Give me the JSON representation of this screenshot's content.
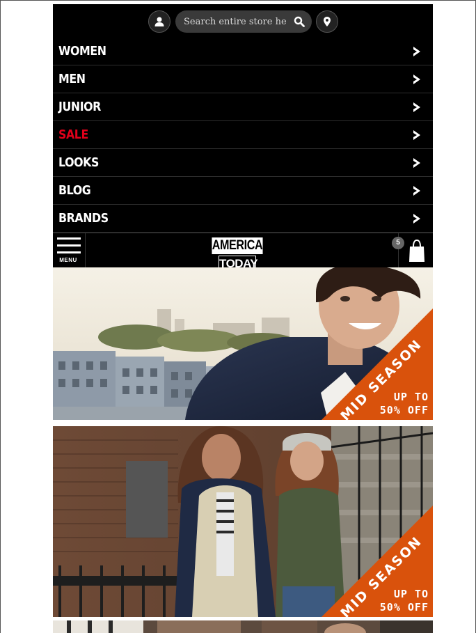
{
  "search": {
    "placeholder": "Search entire store he"
  },
  "icons": {
    "account": "user-icon",
    "search": "search-icon",
    "location": "map-pin-icon",
    "chevron": "chevron-right-icon",
    "cart": "shopping-bag-icon",
    "menu": "hamburger-icon"
  },
  "menu": {
    "items": [
      {
        "label": "WOMEN"
      },
      {
        "label": "MEN"
      },
      {
        "label": "JUNIOR"
      },
      {
        "label": "SALE"
      },
      {
        "label": "LOOKS"
      },
      {
        "label": "BLOG"
      },
      {
        "label": "BRANDS"
      }
    ]
  },
  "header": {
    "menu_label": "MENU",
    "logo_line1": "AMERICA",
    "logo_line2": "TODAY",
    "cart_count": "5"
  },
  "banners": [
    {
      "promo_season": "MID SEASON",
      "promo_line1": "UP TO",
      "promo_line2": "50% OFF"
    },
    {
      "promo_season": "MID SEASON",
      "promo_line1": "UP TO",
      "promo_line2": "50% OFF"
    }
  ],
  "colors": {
    "background": "#000000",
    "sale": "#e2001a",
    "promo": "#d9520c",
    "text": "#ffffff"
  }
}
